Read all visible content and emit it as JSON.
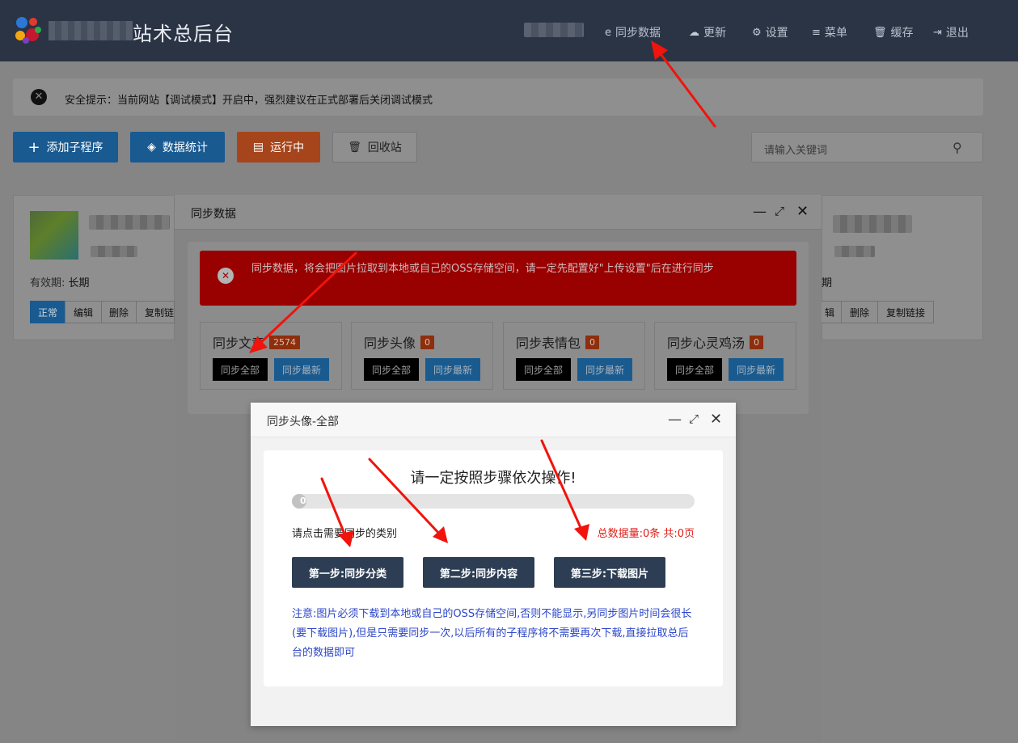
{
  "header": {
    "brand": "站术总后台",
    "nav": [
      {
        "icon": "ie-icon",
        "glyph": "e",
        "label": "同步数据"
      },
      {
        "icon": "cloud-download-icon",
        "glyph": "☁",
        "label": "更新"
      },
      {
        "icon": "gear-icon",
        "glyph": "⚙",
        "label": "设置"
      },
      {
        "icon": "menu-icon",
        "glyph": "≡",
        "label": "菜单"
      },
      {
        "icon": "trash-icon",
        "glyph": "🗑",
        "label": "缓存"
      },
      {
        "icon": "sign-out-icon",
        "glyph": "⇥",
        "label": "退出"
      }
    ]
  },
  "notice": {
    "text": "安全提示：当前网站【调试模式】开启中，强烈建议在正式部署后关闭调试模式"
  },
  "toolbar": {
    "add": "添加子程序",
    "stats": "数据统计",
    "running": "运行中",
    "recycle": "回收站",
    "search_placeholder": "请输入关键词"
  },
  "cards": [
    {
      "validity_label": "有效期:",
      "validity_value": "长期",
      "status": "正常",
      "edit": "编辑",
      "delete": "删除",
      "copy": "复制链"
    },
    {
      "validity_value": "期",
      "edit": "辑",
      "delete": "删除",
      "copy": "复制链接"
    }
  ],
  "dialog_sync": {
    "title": "同步数据",
    "alert": "同步数据，将会把图片拉取到本地或自己的OSS存储空间，请一定先配置好\"上传设置\"后在进行同步",
    "boxes": [
      {
        "title": "同步文章",
        "count": "2574",
        "sync_all": "同步全部",
        "sync_new": "同步最新"
      },
      {
        "title": "同步头像",
        "count": "0",
        "sync_all": "同步全部",
        "sync_new": "同步最新"
      },
      {
        "title": "同步表情包",
        "count": "0",
        "sync_all": "同步全部",
        "sync_new": "同步最新"
      },
      {
        "title": "同步心灵鸡汤",
        "count": "0",
        "sync_all": "同步全部",
        "sync_new": "同步最新"
      }
    ]
  },
  "dialog_avatar": {
    "title": "同步头像-全部",
    "heading": "请一定按照步骤依次操作!",
    "progress": {
      "value": 0,
      "label": "0"
    },
    "select_label": "请点击需要同步的类别",
    "stats": "总数据量:0条 共:0页",
    "steps": [
      "第一步:同步分类",
      "第二步:同步内容",
      "第三步:下载图片"
    ],
    "note": "注意:图片必须下载到本地或自己的OSS存储空间,否则不能显示,另同步图片时间会很长(要下载图片),但是只需要同步一次,以后所有的子程序将不需要再次下载,直接拉取总后台的数据即可"
  },
  "colors": {
    "topbar": "#2b3445",
    "alert_red": "#990000",
    "step_button": "#2d3e54",
    "note_blue": "#2b46c9",
    "stat_red": "#e0201a",
    "arrow_red": "#f0140c"
  }
}
